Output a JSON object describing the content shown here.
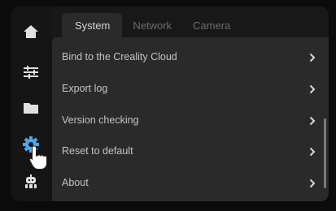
{
  "sidebar": {
    "items": [
      {
        "icon": "home-icon",
        "active": false
      },
      {
        "icon": "sliders-icon",
        "active": false
      },
      {
        "icon": "folder-icon",
        "active": false
      },
      {
        "icon": "gear-icon",
        "active": true
      },
      {
        "icon": "robot-icon",
        "active": false
      }
    ]
  },
  "tabs": [
    {
      "label": "System",
      "active": true
    },
    {
      "label": "Network",
      "active": false
    },
    {
      "label": "Camera",
      "active": false
    }
  ],
  "settings": {
    "items": [
      {
        "label": "Bind to the Creality Cloud",
        "icon": "chevron-right-icon"
      },
      {
        "label": "Export log",
        "icon": "chevron-right-icon"
      },
      {
        "label": "Version checking",
        "icon": "chevron-right-icon"
      },
      {
        "label": "Reset to default",
        "icon": "chevron-right-icon"
      },
      {
        "label": "About",
        "icon": "chevron-right-icon"
      }
    ]
  },
  "colors": {
    "accent": "#4aa8f0",
    "icon": "#e0e0e0",
    "panel": "#2a2a2a",
    "background": "#181818"
  },
  "pointer": {
    "icon": "pointing-hand-icon"
  }
}
